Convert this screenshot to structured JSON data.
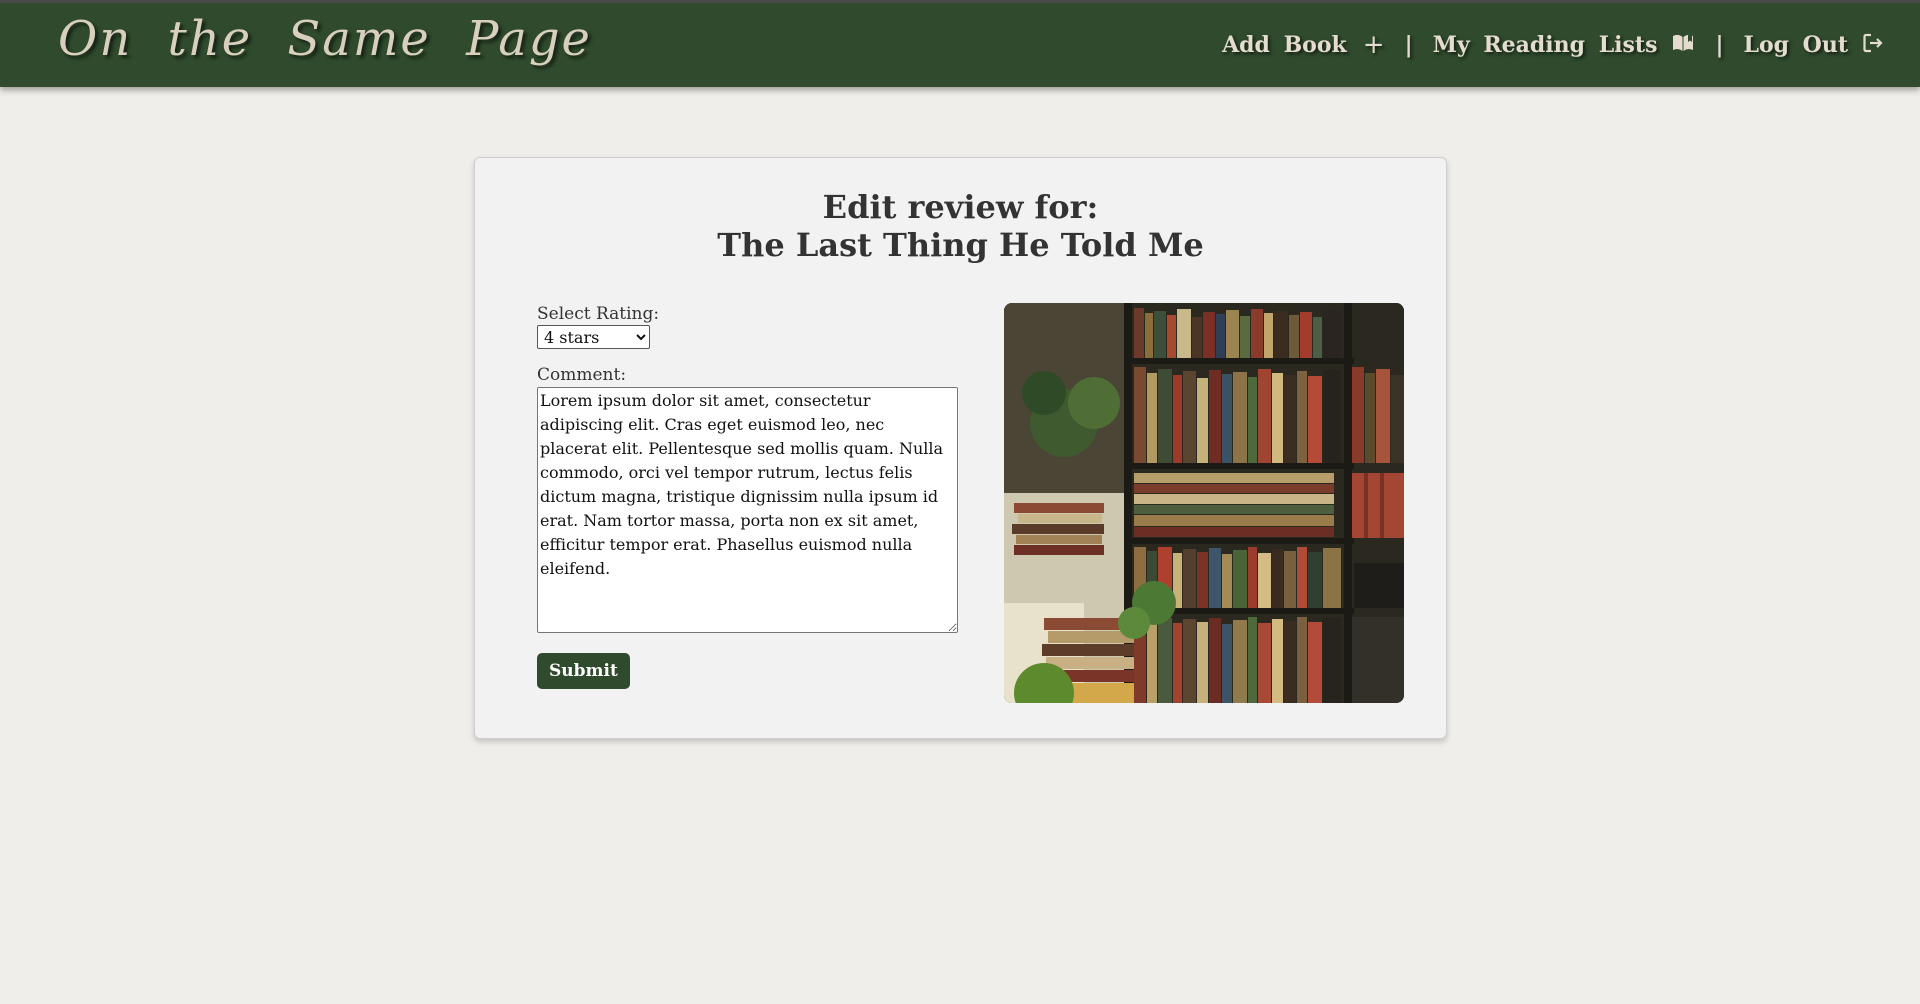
{
  "navbar": {
    "brand": "On the Same Page",
    "links": [
      {
        "label": "Add Book",
        "icon": "plus-icon",
        "glyph": "+"
      },
      {
        "label": "My Reading Lists",
        "icon": "book-open-icon",
        "glyph": "📖"
      },
      {
        "label": "Log Out",
        "icon": "logout-icon",
        "glyph": "⇥"
      }
    ],
    "separator": "|"
  },
  "review_form": {
    "title_line1": "Edit review for:",
    "title_line2": "The Last Thing He Told Me",
    "rating_label": "Select Rating:",
    "rating_value": "4 stars",
    "comment_label": "Comment:",
    "comment_value": "Lorem ipsum dolor sit amet, consectetur adipiscing elit. Cras eget euismod leo, nec placerat elit. Pellentesque sed mollis quam. Nulla commodo, orci vel tempor rutrum, lectus felis dictum magna, tristique dignissim nulla ipsum id erat. Nam tortor massa, porta non ex sit amet, efficitur tempor erat. Phasellus euismod nulla eleifend.",
    "submit_label": "Submit"
  },
  "colors": {
    "navbar": "#2f4a2c",
    "page_background": "#f0eeeb",
    "card_background": "#f2f2f2",
    "nav_text": "#e3dccf",
    "brand_text": "#d8cfbd",
    "button": "#2f4a2c"
  }
}
